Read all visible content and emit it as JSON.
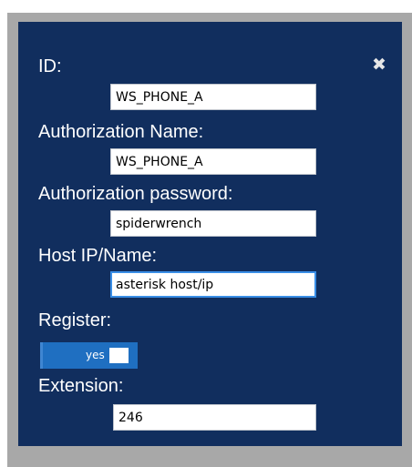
{
  "dialog": {
    "close_icon": "close-icon",
    "fields": {
      "id": {
        "label": "ID:",
        "value": "WS_PHONE_A"
      },
      "auth_name": {
        "label": "Authorization Name:",
        "value": "WS_PHONE_A"
      },
      "auth_password": {
        "label": "Authorization password:",
        "value": "spiderwrench"
      },
      "host": {
        "label": "Host IP/Name:",
        "value": "asterisk host/ip"
      },
      "register": {
        "label": "Register:",
        "value": "yes"
      },
      "extension": {
        "label": "Extension:",
        "value": "246"
      }
    }
  },
  "colors": {
    "dialog_background": "#112e5e",
    "overlay": "#a8a8a8",
    "toggle_on": "#1f6fc1",
    "focus_border": "#3a8ee6"
  }
}
